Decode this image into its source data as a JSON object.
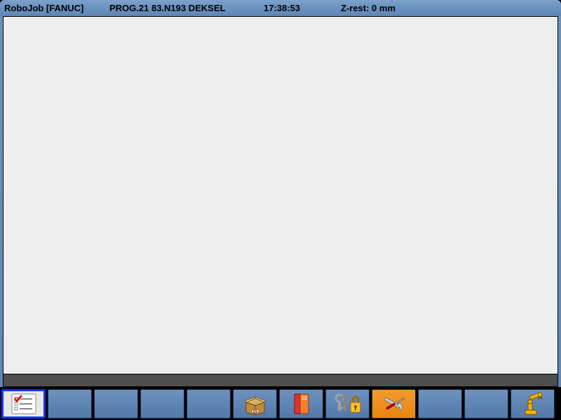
{
  "header": {
    "appName": "RoboJob [FANUC]",
    "program": "PROG.21 83.N193 DEKSEL",
    "time": "17:38:53",
    "zrest": "Z-rest: 0 mm"
  },
  "toolbar": {
    "buttons": [
      {
        "name": "checklist",
        "selected": true
      },
      {
        "name": "blank-1"
      },
      {
        "name": "blank-2"
      },
      {
        "name": "blank-3"
      },
      {
        "name": "blank-4"
      },
      {
        "name": "package"
      },
      {
        "name": "book"
      },
      {
        "name": "lock"
      },
      {
        "name": "tools",
        "orange": true
      },
      {
        "name": "blank-5"
      },
      {
        "name": "blank-6"
      },
      {
        "name": "robot-arm"
      }
    ]
  }
}
